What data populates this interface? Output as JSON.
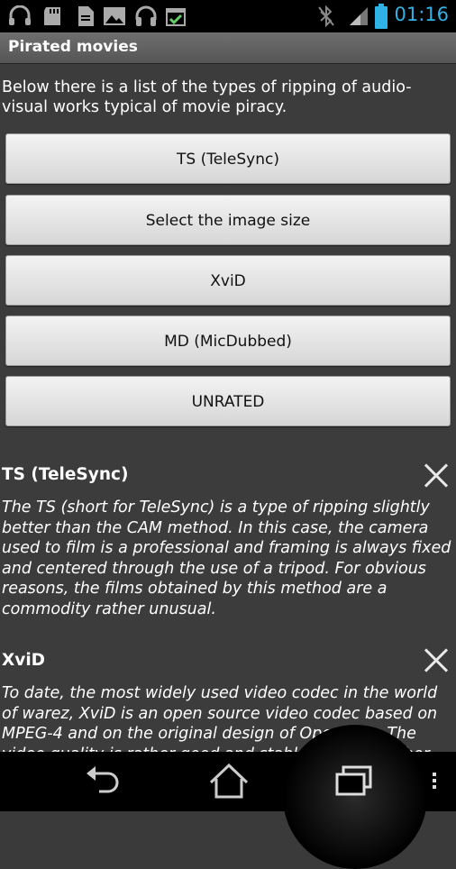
{
  "status": {
    "time": "01:16"
  },
  "app": {
    "title": "Pirated movies"
  },
  "intro": "Below there is a list of the types of ripping of audio-visual works typical of movie piracy.",
  "buttons": [
    "TS (TeleSync)",
    "Select the image size",
    "XviD",
    "MD (MicDubbed)",
    "UNRATED"
  ],
  "sections": [
    {
      "title": "TS (TeleSync)",
      "text": "The TS (short for TeleSync) is a type of ripping slightly better than the CAM method. In this case, the camera used to film is a professional and framing is always fixed and centered through the use of a tripod. For obvious reasons, the films obtained by this method are a commodity rather unusual."
    },
    {
      "title": "XviD",
      "text": "To date, the most widely used video codec in the world of warez, XviD is an open source video codec based on MPEG-4 and on the original design of OpenDivx. The video quality is rather good and stable, slightly higher than"
    }
  ],
  "icons": {
    "status": [
      "headset-icon",
      "sd-card-icon",
      "document-icon",
      "image-icon",
      "headphones-icon",
      "calendar-icon",
      "bluetooth-off-icon",
      "signal-icon",
      "battery-icon"
    ],
    "nav": [
      "back-icon",
      "home-icon",
      "recent-apps-icon",
      "menu-icon"
    ],
    "close": "close-icon"
  },
  "colors": {
    "time": "#2fb3e6",
    "background": "#3c3c3c",
    "button": "#e6e6e6"
  }
}
